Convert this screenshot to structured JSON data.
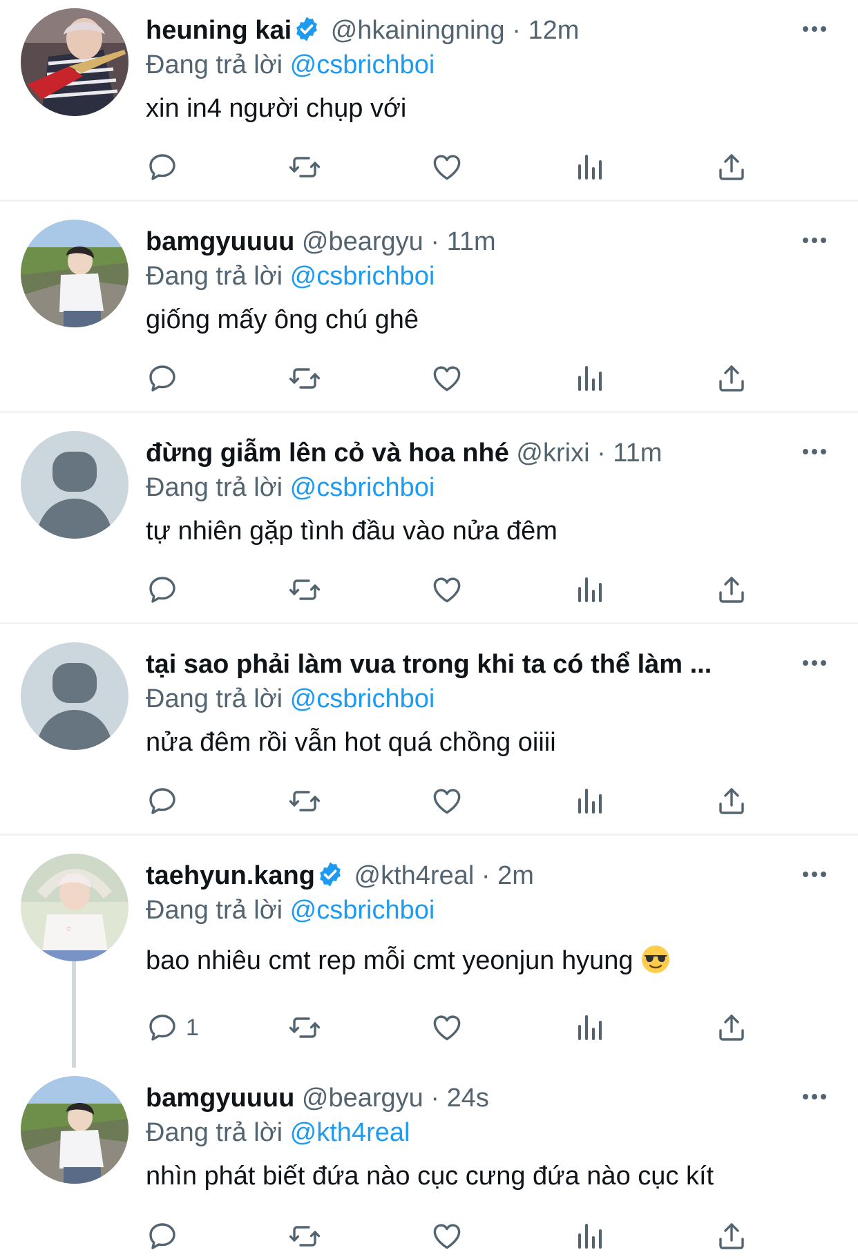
{
  "colors": {
    "accent": "#1d9bf0",
    "text": "#0f1419",
    "muted": "#536471",
    "divider": "#eff3f4"
  },
  "tweets": [
    {
      "name": "heuning kai",
      "verified": true,
      "handle": "@hkainingning",
      "separator": "·",
      "time": "12m",
      "reply_label": "Đang trả lời",
      "reply_to": "@csbrichboi",
      "text": "xin in4 người chụp với",
      "reply_count": ""
    },
    {
      "name": "bamgyuuuu",
      "verified": false,
      "handle": "@beargyu",
      "separator": "·",
      "time": "11m",
      "reply_label": "Đang trả lời",
      "reply_to": "@csbrichboi",
      "text": "giống mấy ông chú ghê",
      "reply_count": ""
    },
    {
      "name": "đừng giẫm lên cỏ và hoa nhé",
      "verified": false,
      "handle": "@krixi",
      "separator": "·",
      "time": "11m",
      "reply_label": "Đang trả lời",
      "reply_to": "@csbrichboi",
      "text": "tự nhiên gặp tình đầu vào nửa đêm",
      "reply_count": ""
    },
    {
      "name": "tại sao phải làm vua trong khi ta có thể làm ...",
      "verified": false,
      "handle": "",
      "separator": "",
      "time": "",
      "reply_label": "Đang trả lời",
      "reply_to": "@csbrichboi",
      "text": "nửa đêm rồi vẫn hot quá chồng oiiii",
      "reply_count": ""
    },
    {
      "name": "taehyun.kang",
      "verified": true,
      "handle": "@kth4real",
      "separator": "·",
      "time": "2m",
      "reply_label": "Đang trả lời",
      "reply_to": "@csbrichboi",
      "text": "bao nhiêu cmt rep mỗi cmt yeonjun hyung",
      "emoji": "smiling-face-with-sunglasses",
      "reply_count": "1"
    },
    {
      "name": "bamgyuuuu",
      "verified": false,
      "handle": "@beargyu",
      "separator": "·",
      "time": "24s",
      "reply_label": "Đang trả lời",
      "reply_to": "@kth4real",
      "text": "nhìn phát biết đứa nào cục cưng đứa nào cục kít",
      "reply_count": ""
    }
  ]
}
